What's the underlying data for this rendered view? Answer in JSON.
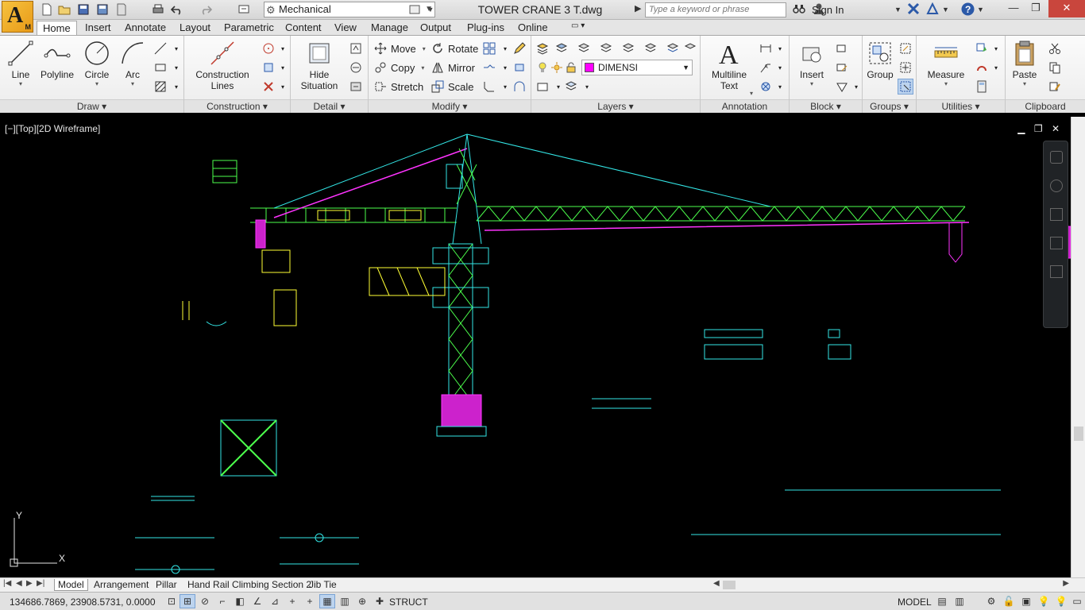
{
  "titlebar": {
    "workspace": "Mechanical",
    "document_title": "TOWER CRANE 3 T.dwg",
    "search_placeholder": "Type a keyword or phrase",
    "sign_in": "Sign In"
  },
  "app_logo": {
    "letter": "A",
    "sub": "M"
  },
  "ribbon_tabs": [
    "Home",
    "Insert",
    "Annotate",
    "Layout",
    "Parametric",
    "Content",
    "View",
    "Manage",
    "Output",
    "Plug-ins",
    "Online"
  ],
  "active_tab": "Home",
  "draw_panel": {
    "title": "Draw",
    "line": "Line",
    "polyline": "Polyline",
    "circle": "Circle",
    "arc": "Arc"
  },
  "construction_panel": {
    "title": "Construction",
    "construction_lines_1": "Construction",
    "construction_lines_2": "Lines"
  },
  "detail_panel": {
    "title": "Detail",
    "hide_1": "Hide",
    "hide_2": "Situation"
  },
  "modify_panel": {
    "title": "Modify",
    "move": "Move",
    "rotate": "Rotate",
    "copy": "Copy",
    "mirror": "Mirror",
    "stretch": "Stretch",
    "scale": "Scale"
  },
  "layers_panel": {
    "title": "Layers",
    "current_layer": "DIMENSI",
    "layer_color": "#ff00ff"
  },
  "annotation_panel": {
    "title": "Annotation",
    "mtext_1": "Multiline",
    "mtext_2": "Text"
  },
  "block_panel": {
    "title": "Block",
    "insert": "Insert"
  },
  "groups_panel": {
    "title": "Groups",
    "group": "Group"
  },
  "utilities_panel": {
    "title": "Utilities",
    "measure": "Measure"
  },
  "clipboard_panel": {
    "title": "Clipboard",
    "paste": "Paste"
  },
  "viewport": {
    "label": "[−][Top][2D Wireframe]"
  },
  "layout_tabs": [
    "Model",
    "Arrangement",
    "Pillar",
    "Hand Rail Climbing Section 2",
    "Jib Tie"
  ],
  "active_layout": "Model",
  "statusbar": {
    "coords": "134686.7869, 23908.5731, 0.0000",
    "struct": "STRUCT",
    "model": "MODEL"
  },
  "colors": {
    "cyan": "#33e6e6",
    "green": "#4cff4c",
    "yellow": "#ffff33",
    "magenta": "#ff33ff",
    "select_blue": "#bcd3ee"
  }
}
